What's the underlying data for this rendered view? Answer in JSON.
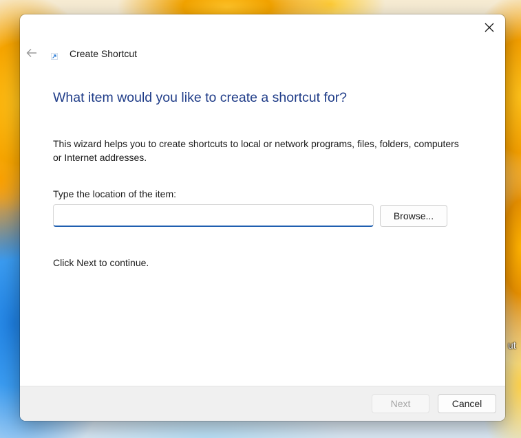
{
  "window": {
    "title": "Create Shortcut",
    "icons": {
      "close": "close-icon",
      "back": "back-arrow-icon",
      "app": "shortcut-icon"
    }
  },
  "main": {
    "heading": "What item would you like to create a shortcut for?",
    "description": "This wizard helps you to create shortcuts to local or network programs, files, folders, computers or Internet addresses.",
    "location_label": "Type the location of the item:",
    "location_value": "",
    "browse_label": "Browse...",
    "next_hint": "Click Next to continue."
  },
  "footer": {
    "next_label": "Next",
    "cancel_label": "Cancel"
  },
  "desktop": {
    "partial_label": "ut"
  },
  "colors": {
    "heading": "#1f3c88",
    "input_focus": "#1f5fb0",
    "disabled_text": "#a3a3a3"
  }
}
